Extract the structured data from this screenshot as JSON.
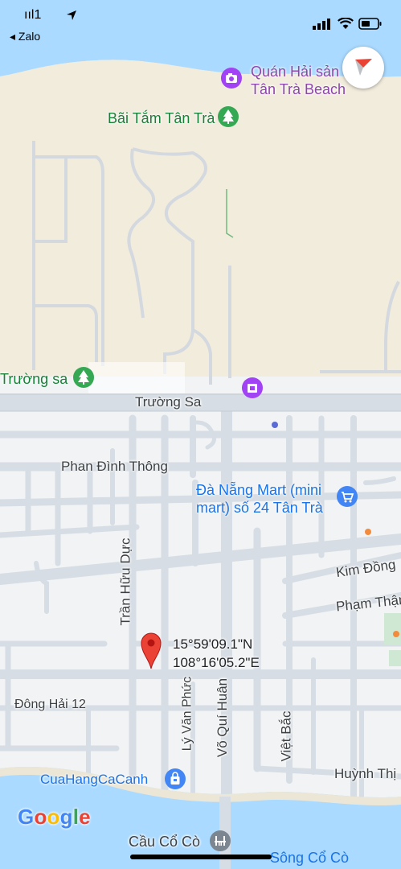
{
  "status_bar": {
    "carrier": "ııl1",
    "back_app": "◂ Zalo"
  },
  "map": {
    "colors": {
      "water": "#aadaff",
      "sand": "#f2ecdd",
      "land": "#f1f3f4",
      "road": "#d7dde4",
      "road_outline": "#c4cbd3",
      "park_icon": "#34a853",
      "shop_icon": "#4285f4",
      "purple_icon": "#a142f4",
      "pin": "#ea4335"
    },
    "pois": {
      "restaurant": {
        "label_line1": "Quán Hải sản",
        "label_line2": "Tân Trà Beach",
        "icon": "camera-icon"
      },
      "beach": {
        "label": "Bãi Tắm Tân Trà",
        "icon": "tree-icon"
      },
      "truong_sa_park": {
        "label": "Trường sa",
        "icon": "tree-icon"
      },
      "mart": {
        "label_line1": "Đà Nẵng Mart (mini",
        "label_line2": "mart) số 24 Tân Trà",
        "icon": "shopping-cart-icon"
      },
      "fish_shop": {
        "label": "CuaHangCaCanh",
        "icon": "shopping-bag-icon"
      },
      "purple_place": {
        "icon": "building-icon"
      },
      "bridge": {
        "label": "Cầu Cổ Cò",
        "icon": "bridge-icon"
      }
    },
    "roads": {
      "truong_sa": "Trường Sa",
      "phan_dinh_thong": "Phan Đình Thông",
      "tran_huu_duc": "Trần Hữu Dực",
      "kim_dong": "Kim Đồng",
      "pham_than": "Phạm Thận",
      "dong_hai_12": "Đông Hải 12",
      "ly_van_phuc": "Lý Văn Phức",
      "vo_qui_huan": "Võ Quí Huân",
      "viet_bac": "Việt Bắc",
      "huynh_thi": "Huỳnh Thị"
    },
    "water_label": "Sông Cổ Cò",
    "pin": {
      "lat": "15°59'09.1\"N",
      "lng": "108°16'05.2\"E"
    },
    "attribution": "Google"
  }
}
